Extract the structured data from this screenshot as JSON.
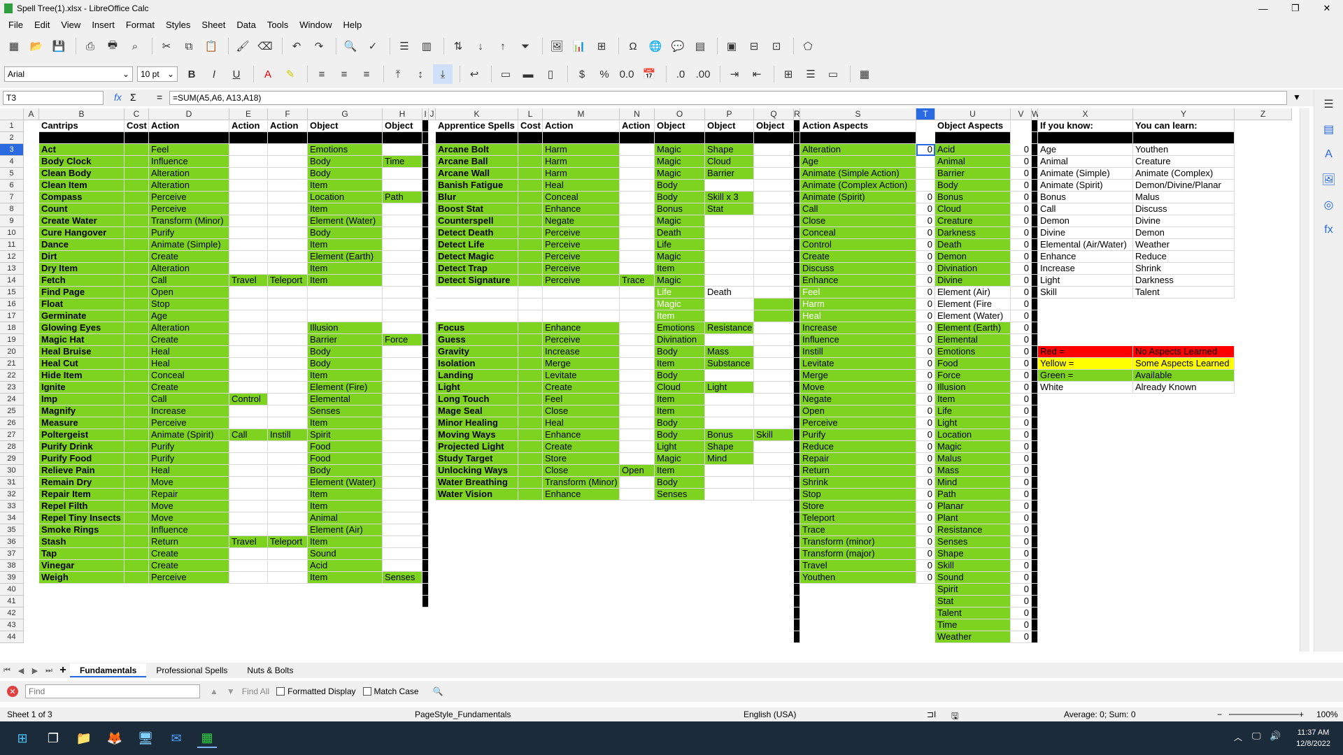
{
  "window": {
    "title": "Spell Tree(1).xlsx - LibreOffice Calc",
    "min": "—",
    "max": "❐",
    "close": "✕"
  },
  "menu": [
    "File",
    "Edit",
    "View",
    "Insert",
    "Format",
    "Styles",
    "Sheet",
    "Data",
    "Tools",
    "Window",
    "Help"
  ],
  "font": {
    "name": "Arial",
    "size": "10 pt"
  },
  "formula": {
    "cell_ref": "T3",
    "content": "=SUM(A5,A6, A13,A18)",
    "fx": "fx",
    "sum": "Σ",
    "eq": "="
  },
  "columns": [
    {
      "l": "A",
      "w": 22
    },
    {
      "l": "B",
      "w": 122
    },
    {
      "l": "C",
      "w": 35
    },
    {
      "l": "D",
      "w": 115
    },
    {
      "l": "E",
      "w": 55
    },
    {
      "l": "F",
      "w": 57
    },
    {
      "l": "G",
      "w": 107
    },
    {
      "l": "H",
      "w": 57
    },
    {
      "l": "I",
      "w": 9
    },
    {
      "l": "J",
      "w": 10
    },
    {
      "l": "K",
      "w": 118
    },
    {
      "l": "L",
      "w": 35
    },
    {
      "l": "M",
      "w": 110
    },
    {
      "l": "N",
      "w": 50
    },
    {
      "l": "O",
      "w": 72
    },
    {
      "l": "P",
      "w": 70
    },
    {
      "l": "Q",
      "w": 57
    },
    {
      "l": "R",
      "w": 9
    },
    {
      "l": "S",
      "w": 166
    },
    {
      "l": "T",
      "w": 27
    },
    {
      "l": "U",
      "w": 108
    },
    {
      "l": "V",
      "w": 30
    },
    {
      "l": "W",
      "w": 9
    },
    {
      "l": "X",
      "w": 136
    },
    {
      "l": "Y",
      "w": 145
    },
    {
      "l": "Z",
      "w": 82
    }
  ],
  "headers": {
    "B": "Cantrips",
    "C": "Cost",
    "D": "Action",
    "E": "Action",
    "F": "Action",
    "G": "Object",
    "H": "Object",
    "K": "Apprentice Spells",
    "L": "Cost",
    "M": "Action",
    "N": "Action",
    "O": "Object",
    "P": "Object",
    "Q": "Object",
    "S": "Action Aspects",
    "U": "Object Aspects",
    "X": "If you know:",
    "Y": "You can learn:"
  },
  "cantrips": [
    [
      "Act",
      "Feel",
      "",
      "",
      "Emotions",
      ""
    ],
    [
      "Body Clock",
      "Influence",
      "",
      "",
      "Body",
      "Time"
    ],
    [
      "Clean Body",
      "Alteration",
      "",
      "",
      "Body",
      ""
    ],
    [
      "Clean Item",
      "Alteration",
      "",
      "",
      "Item",
      ""
    ],
    [
      "Compass",
      "Perceive",
      "",
      "",
      "Location",
      "Path"
    ],
    [
      "Count",
      "Perceive",
      "",
      "",
      "Item",
      ""
    ],
    [
      "Create Water",
      "Transform (Minor)",
      "",
      "",
      "Element (Water)",
      ""
    ],
    [
      "Cure Hangover",
      "Purify",
      "",
      "",
      "Body",
      ""
    ],
    [
      "Dance",
      "Animate (Simple)",
      "",
      "",
      "Item",
      ""
    ],
    [
      "Dirt",
      "Create",
      "",
      "",
      "Element (Earth)",
      ""
    ],
    [
      "Dry Item",
      "Alteration",
      "",
      "",
      "Item",
      ""
    ],
    [
      "Fetch",
      "Call",
      "Travel",
      "Teleport",
      "Item",
      ""
    ],
    [
      "Find Page",
      "Open",
      "",
      "",
      "",
      ""
    ],
    [
      "Float",
      "Stop",
      "",
      "",
      "",
      ""
    ],
    [
      "Germinate",
      "Age",
      "",
      "",
      "",
      ""
    ],
    [
      "Glowing Eyes",
      "Alteration",
      "",
      "",
      "Illusion",
      ""
    ],
    [
      "Magic Hat",
      "Create",
      "",
      "",
      "Barrier",
      "Force"
    ],
    [
      "Heal Bruise",
      "Heal",
      "",
      "",
      "Body",
      ""
    ],
    [
      "Heal Cut",
      "Heal",
      "",
      "",
      "Body",
      ""
    ],
    [
      "Hide Item",
      "Conceal",
      "",
      "",
      "Item",
      ""
    ],
    [
      "Ignite",
      "Create",
      "",
      "",
      "Element (Fire)",
      ""
    ],
    [
      "Imp",
      "Call",
      "Control",
      "",
      "Elemental",
      ""
    ],
    [
      "Magnify",
      "Increase",
      "",
      "",
      "Senses",
      ""
    ],
    [
      "Measure",
      "Perceive",
      "",
      "",
      "Item",
      ""
    ],
    [
      "Poltergeist",
      "Animate (Spirit)",
      "Call",
      "Instill",
      "Spirit",
      ""
    ],
    [
      "Purify Drink",
      "Purify",
      "",
      "",
      "Food",
      ""
    ],
    [
      "Purify Food",
      "Purify",
      "",
      "",
      "Food",
      ""
    ],
    [
      "Relieve Pain",
      "Heal",
      "",
      "",
      "Body",
      ""
    ],
    [
      "Remain Dry",
      "Move",
      "",
      "",
      "Element (Water)",
      ""
    ],
    [
      "Repair Item",
      "Repair",
      "",
      "",
      "Item",
      ""
    ],
    [
      "Repel Filth",
      "Move",
      "",
      "",
      "Item",
      ""
    ],
    [
      "Repel Tiny Insects",
      "Move",
      "",
      "",
      "Animal",
      ""
    ],
    [
      "Smoke Rings",
      "Influence",
      "",
      "",
      "Element (Air)",
      ""
    ],
    [
      "Stash",
      "Return",
      "Travel",
      "Teleport",
      "Item",
      ""
    ],
    [
      "Tap",
      "Create",
      "",
      "",
      "Sound",
      ""
    ],
    [
      "Vinegar",
      "Create",
      "",
      "",
      "Acid",
      ""
    ],
    [
      "Weigh",
      "Perceive",
      "",
      "",
      "Item",
      "Senses"
    ]
  ],
  "apprentice": [
    [
      "Arcane Bolt",
      "Harm",
      "",
      "Magic",
      "Shape",
      ""
    ],
    [
      "Arcane Ball",
      "Harm",
      "",
      "Magic",
      "Cloud",
      ""
    ],
    [
      "Arcane Wall",
      "Harm",
      "",
      "Magic",
      "Barrier",
      ""
    ],
    [
      "Banish Fatigue",
      "Heal",
      "",
      "Body",
      "",
      ""
    ],
    [
      "Blur",
      "Conceal",
      "",
      "Body",
      "Skill x 3",
      ""
    ],
    [
      "Boost Stat",
      "Enhance",
      "",
      "Bonus",
      "Stat",
      ""
    ],
    [
      "Counterspell",
      "Negate",
      "",
      "Magic",
      "",
      ""
    ],
    [
      "Detect Death",
      "Perceive",
      "",
      "Death",
      "",
      ""
    ],
    [
      "Detect Life",
      "Perceive",
      "",
      "Life",
      "",
      ""
    ],
    [
      "Detect Magic",
      "Perceive",
      "",
      "Magic",
      "",
      ""
    ],
    [
      "Detect Trap",
      "Perceive",
      "",
      "Item",
      "",
      ""
    ],
    [
      "Detect Signature",
      "Perceive",
      "Trace",
      "Magic",
      "",
      ""
    ],
    [
      "",
      "",
      "",
      "Life",
      "Death",
      ""
    ],
    [
      "",
      "",
      "",
      "Magic",
      "",
      ""
    ],
    [
      "",
      "",
      "",
      "Item",
      "",
      ""
    ],
    [
      "Focus",
      "Enhance",
      "",
      "Emotions",
      "Resistance",
      ""
    ],
    [
      "Guess",
      "Perceive",
      "",
      "Divination",
      "",
      ""
    ],
    [
      "Gravity",
      "Increase",
      "",
      "Body",
      "Mass",
      ""
    ],
    [
      "Isolation",
      "Merge",
      "",
      "Item",
      "Substance",
      ""
    ],
    [
      "Landing",
      "Levitate",
      "",
      "Body",
      "",
      ""
    ],
    [
      "Light",
      "Create",
      "",
      "Cloud",
      "Light",
      ""
    ],
    [
      "Long Touch",
      "Feel",
      "",
      "Item",
      "",
      ""
    ],
    [
      "Mage Seal",
      "Close",
      "",
      "Item",
      "",
      ""
    ],
    [
      "Minor Healing",
      "Heal",
      "",
      "Body",
      "",
      ""
    ],
    [
      "Moving Ways",
      "Enhance",
      "",
      "Body",
      "Bonus",
      "Skill"
    ],
    [
      "Projected Light",
      "Create",
      "",
      "Light",
      "Shape",
      ""
    ],
    [
      "Study Target",
      "Store",
      "",
      "Magic",
      "Mind",
      ""
    ],
    [
      "Unlocking Ways",
      "Close",
      "Open",
      "Item",
      "",
      ""
    ],
    [
      "Water Breathing",
      "Transform (Minor)",
      "",
      "Body",
      "",
      ""
    ],
    [
      "Water Vision",
      "Enhance",
      "",
      "Senses",
      "",
      ""
    ]
  ],
  "action_aspects": [
    "Alteration",
    "Age",
    "Animate (Simple Action)",
    "Animate (Complex Action)",
    "Animate (Spirit)",
    "Call",
    "Close",
    "Conceal",
    "Control",
    "Create",
    "Discuss",
    "Enhance",
    "Feel",
    "Harm",
    "Heal",
    "Increase",
    "Influence",
    "Instill",
    "Levitate",
    "Merge",
    "Move",
    "Negate",
    "Open",
    "Perceive",
    "Purify",
    "Reduce",
    "Repair",
    "Return",
    "Shrink",
    "Stop",
    "Store",
    "Teleport",
    "Trace",
    "Transform (minor)",
    "Transform (major)",
    "Travel",
    "Youthen"
  ],
  "object_aspects": [
    "Acid",
    "Animal",
    "Barrier",
    "Body",
    "Bonus",
    "Cloud",
    "Creature",
    "Darkness",
    "Death",
    "Demon",
    "Divination",
    "Divine",
    "Element (Air)",
    "Element (Fire",
    "Element (Water)",
    "Element (Earth)",
    "Elemental",
    "Emotions",
    "Food",
    "Force",
    "Illusion",
    "Item",
    "Life",
    "Light",
    "Location",
    "Magic",
    "Malus",
    "Mass",
    "Mind",
    "Path",
    "Planar",
    "Plant",
    "Resistance",
    "Senses",
    "Shape",
    "Skill",
    "Sound",
    "Spirit",
    "Stat",
    "Talent",
    "Time",
    "Weather"
  ],
  "zero": "0",
  "learn": [
    [
      "Age",
      "Youthen"
    ],
    [
      "Animal",
      "Creature"
    ],
    [
      "Animate (Simple)",
      "Animate (Complex)"
    ],
    [
      "Animate (Spirit)",
      "Demon/Divine/Planar"
    ],
    [
      "Bonus",
      "Malus"
    ],
    [
      "Call",
      "Discuss"
    ],
    [
      "Demon",
      "Divine"
    ],
    [
      "Divine",
      "Demon"
    ],
    [
      "Elemental (Air/Water)",
      "Weather"
    ],
    [
      "Enhance",
      "Reduce"
    ],
    [
      "Increase",
      "Shrink"
    ],
    [
      "Light",
      "Darkness"
    ],
    [
      "Skill",
      "Talent"
    ]
  ],
  "legend": [
    [
      "Red =",
      "No Aspects Learned"
    ],
    [
      "Yellow =",
      "Some Aspects Learned"
    ],
    [
      "Green =",
      "Available"
    ],
    [
      "White",
      "Already Known"
    ]
  ],
  "colors": {
    "green": "#7ed321",
    "red": "#ff0000",
    "yellow": "#ffff00",
    "black": "#000000"
  },
  "tabs": [
    "Fundamentals",
    "Professional Spells",
    "Nuts & Bolts"
  ],
  "find": {
    "placeholder": "Find",
    "find_all": "Find All",
    "formatted": "Formatted Display",
    "match_case": "Match Case"
  },
  "status": {
    "sheet": "Sheet 1 of 3",
    "style": "PageStyle_Fundamentals",
    "lang": "English (USA)",
    "sum": "Average: 0; Sum: 0",
    "zoom": "100%"
  },
  "clock": {
    "time": "11:37 AM",
    "date": "12/8/2022"
  }
}
